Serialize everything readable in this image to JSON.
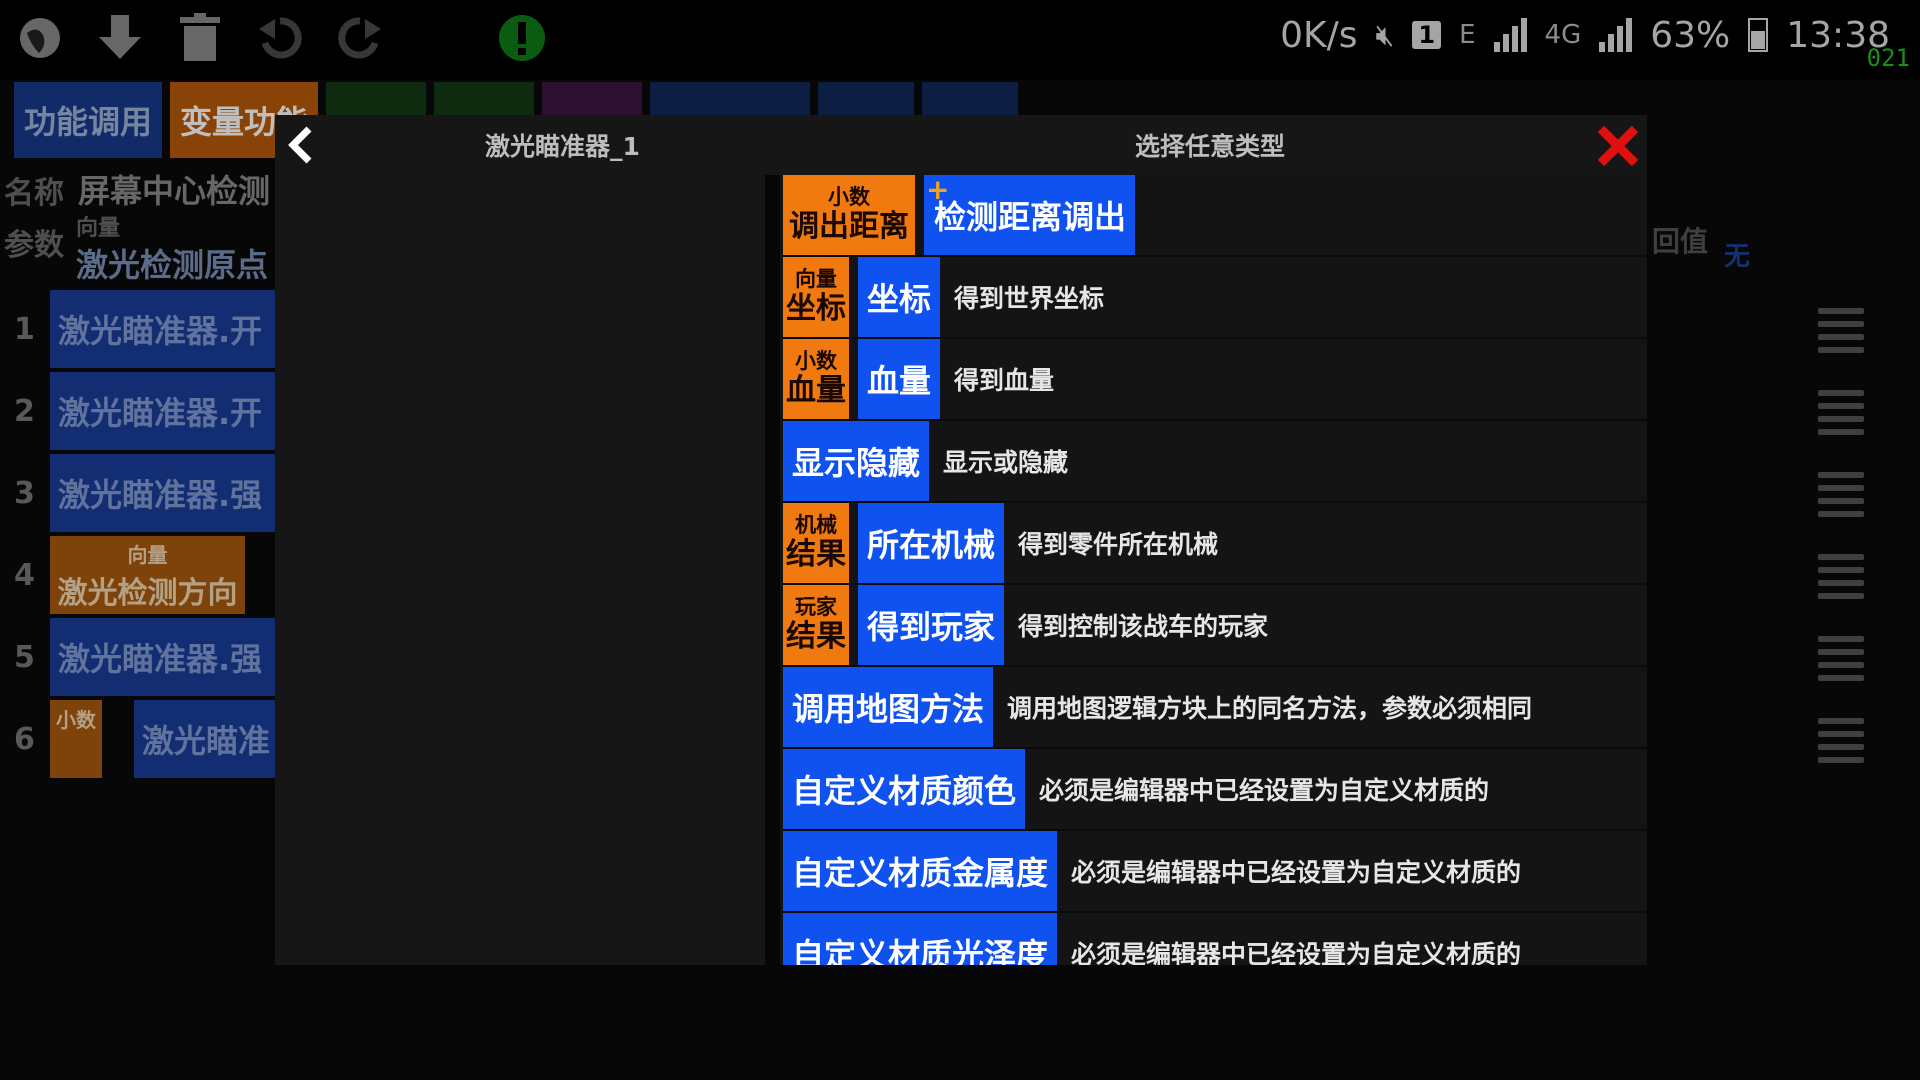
{
  "status_bar": {
    "net_speed": "0K/s",
    "sim_badge": "1",
    "net_type_e": "E",
    "net_type_4g": "4G",
    "battery": "63%",
    "time": "13:38",
    "corner_code": "021"
  },
  "toolbar": {
    "icons": [
      "globe-icon",
      "download-icon",
      "trash-icon",
      "undo-icon",
      "redo-icon",
      "info-icon"
    ]
  },
  "background_tabs": [
    "功能调用",
    "变量功能"
  ],
  "background_editor": {
    "name_label": "名称",
    "name_value": "屏幕中心检测",
    "param_label": "参数",
    "param_type": "向量",
    "param_value": "激光检测原点",
    "return_label": "回值",
    "return_value": "无",
    "rows": [
      {
        "num": "1",
        "text": "激光瞄准器.开"
      },
      {
        "num": "2",
        "text": "激光瞄准器.开"
      },
      {
        "num": "3",
        "text": "激光瞄准器.强"
      },
      {
        "num": "4",
        "type": "向量",
        "text": "激光检测方向"
      },
      {
        "num": "5",
        "text": "激光瞄准器.强"
      },
      {
        "num": "6",
        "type": "小数",
        "text": "激光瞄准"
      }
    ]
  },
  "modal": {
    "left_title": "激光瞄准器_1",
    "right_title": "选择任意类型",
    "items": [
      {
        "type_top": "小数",
        "type_main": "调出距离",
        "name": "检测距离调出",
        "desc": "",
        "plus": "+"
      },
      {
        "type_top": "向量",
        "type_main": "坐标",
        "name": "坐标",
        "desc": "得到世界坐标"
      },
      {
        "type_top": "小数",
        "type_main": "血量",
        "name": "血量",
        "desc": "得到血量"
      },
      {
        "name": "显示隐藏",
        "desc": "显示或隐藏"
      },
      {
        "type_top": "机械",
        "type_main": "结果",
        "name": "所在机械",
        "desc": "得到零件所在机械"
      },
      {
        "type_top": "玩家",
        "type_main": "结果",
        "name": "得到玩家",
        "desc": "得到控制该战车的玩家"
      },
      {
        "name": "调用地图方法",
        "desc": "调用地图逻辑方块上的同名方法，参数必须相同"
      },
      {
        "name": "自定义材质颜色",
        "desc": "必须是编辑器中已经设置为自定义材质的"
      },
      {
        "name": "自定义材质金属度",
        "desc": "必须是编辑器中已经设置为自定义材质的"
      },
      {
        "name": "自定义材质光泽度",
        "desc": "必须是编辑器中已经设置为自定义材质的"
      }
    ]
  }
}
